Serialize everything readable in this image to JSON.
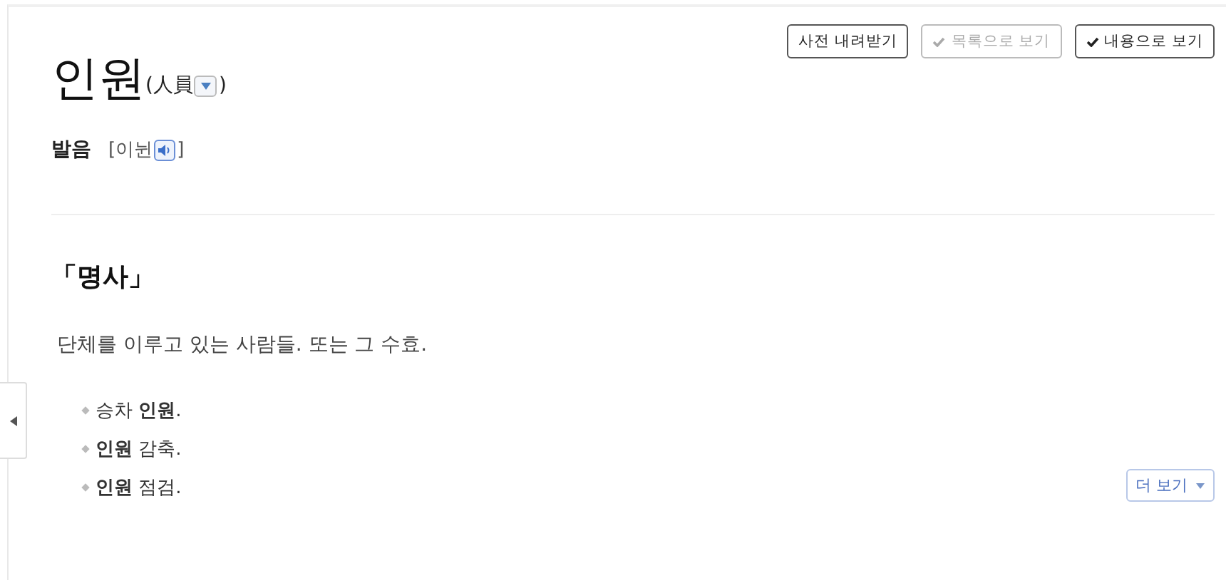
{
  "toolbar": {
    "buttons": [
      {
        "label": "사전 내려받기",
        "kind": "plain"
      },
      {
        "label": "목록으로 보기",
        "kind": "toggle",
        "selected": false
      },
      {
        "label": "내용으로 보기",
        "kind": "toggle",
        "selected": true
      }
    ]
  },
  "entry": {
    "headword": "인원",
    "hanja_open": "(人員",
    "hanja_close": ")",
    "pronunciation": {
      "label": "발음",
      "open": "[이뉜",
      "close": "]"
    }
  },
  "sense": {
    "part_of_speech": "「명사」",
    "definition": "단체를 이루고 있는 사람들. 또는 그 수효.",
    "examples": [
      "승차 **인원**.",
      "**인원** 감축.",
      "**인원** 점검."
    ],
    "more": "더 보기"
  }
}
